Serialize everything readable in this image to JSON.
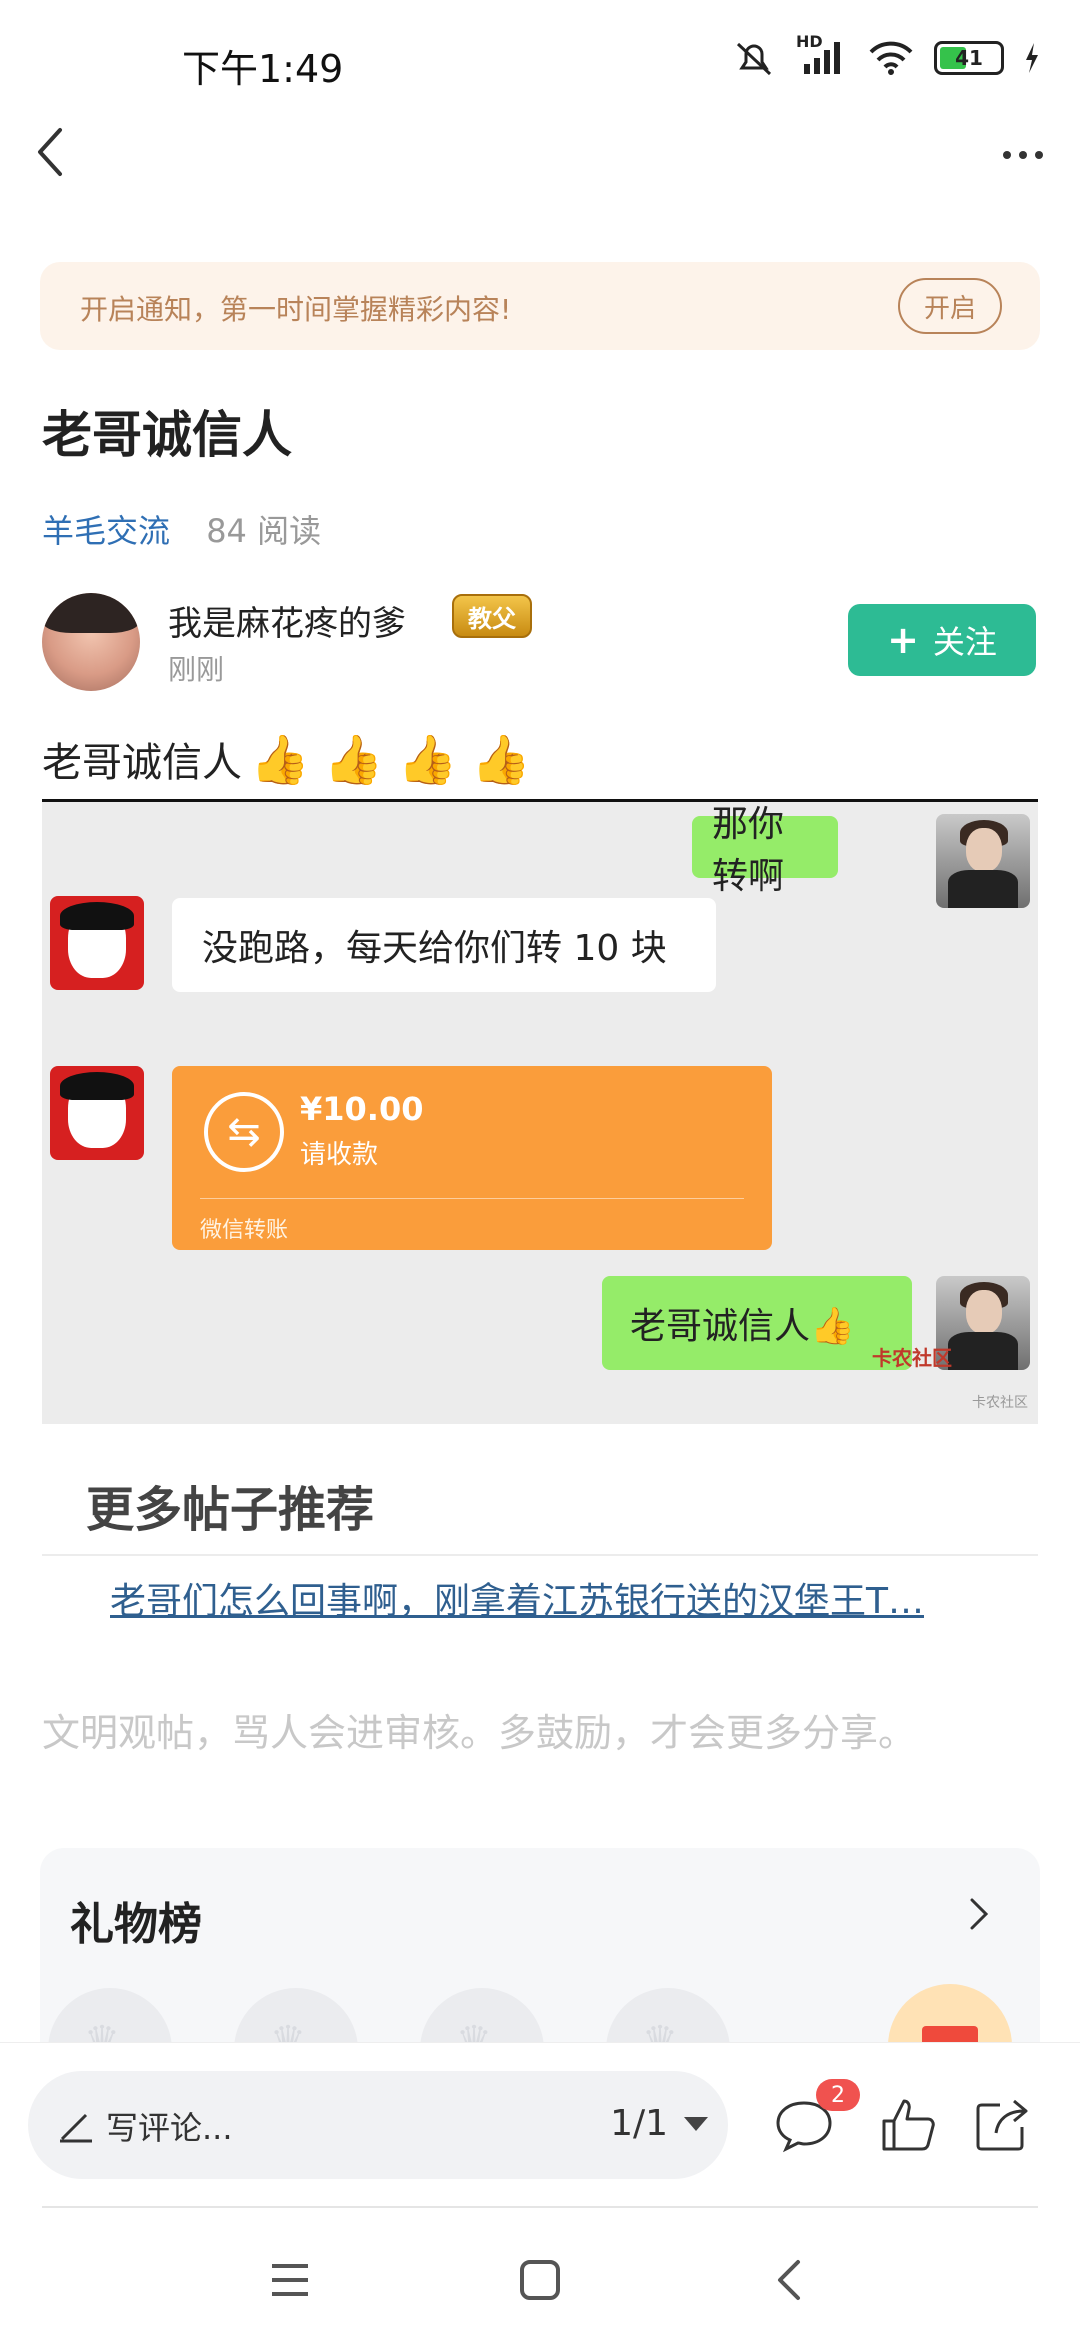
{
  "status_bar": {
    "time": "下午1:49",
    "network": "HD",
    "battery": "41"
  },
  "notify": {
    "text": "开启通知，第一时间掌握精彩内容!",
    "button": "开启"
  },
  "post": {
    "title": "老哥诚信人",
    "forum": "羊毛交流",
    "reads": "84 阅读",
    "author": {
      "name": "我是麻花疼的爹",
      "badge": "教父",
      "time": "刚刚"
    },
    "follow_label": "关注",
    "body_text": "老哥诚信人",
    "body_emojis": [
      "👍",
      "👍",
      "👍",
      "👍"
    ]
  },
  "chat": {
    "msg1": "那你转啊",
    "msg2": "没跑路，每天给你们转 10 块",
    "transfer_amount": "¥10.00",
    "transfer_sub": "请收款",
    "transfer_footer": "微信转账",
    "msg3": "老哥诚信人👍",
    "watermark": "卡农社区",
    "watermark_sub": "卡农社区"
  },
  "more": {
    "title": "更多帖子推荐",
    "link": "老哥们怎么回事啊，刚拿着江苏银行送的汉堡王T…"
  },
  "civil_notice": "文明观帖，骂人会进审核。多鼓励，才会更多分享。",
  "gift": {
    "title": "礼物榜"
  },
  "action_bar": {
    "comment_placeholder": "写评论...",
    "page": "1/1",
    "comment_count": "2"
  },
  "colors": {
    "accent_green": "#2dbb94",
    "forum_blue": "#2f6fb4",
    "notify_bg": "#fdf3ea",
    "transfer_orange": "#fa9d3b",
    "chat_green": "#95ec69"
  }
}
